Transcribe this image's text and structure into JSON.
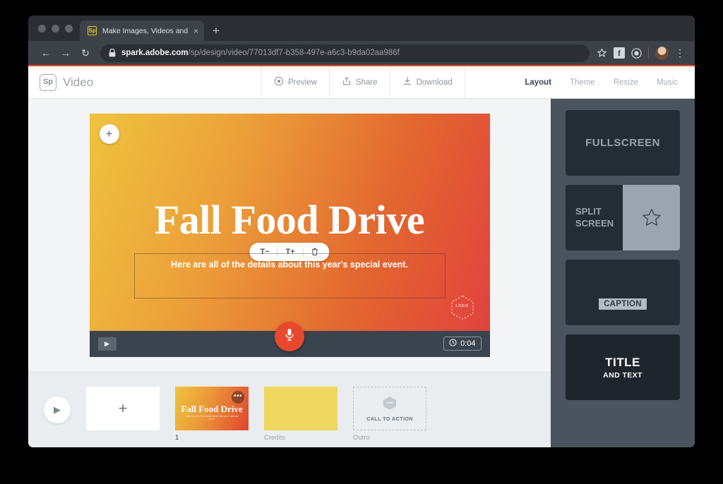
{
  "browser": {
    "tab": {
      "title": "Make Images, Videos and Web",
      "favicon_label": "Sp",
      "close_label": "×"
    },
    "new_tab_label": "+",
    "url": {
      "domain": "spark.adobe.com",
      "path": "/sp/design/video/77013df7-b358-497e-a6c3-b9da02aa986f"
    },
    "icons": {
      "back": "back-arrow-icon",
      "forward": "forward-arrow-icon",
      "reload": "reload-icon",
      "lock": "lock-icon",
      "bookmark": "star-icon",
      "facebook": "facebook-icon",
      "extension": "extension-icon",
      "avatar": "profile-avatar",
      "menu": "kebab-menu-icon"
    },
    "facebook_glyph": "f",
    "menu_glyph": "⋮",
    "back_glyph": "←",
    "forward_glyph": "→",
    "reload_glyph": "↻"
  },
  "header": {
    "logo_label": "Sp",
    "brand": "Video",
    "tools": [
      {
        "label": "Preview",
        "icon": "eye-icon"
      },
      {
        "label": "Share",
        "icon": "share-upload-icon"
      },
      {
        "label": "Download",
        "icon": "download-icon"
      }
    ],
    "nav": [
      {
        "label": "Layout",
        "active": true
      },
      {
        "label": "Theme",
        "active": false
      },
      {
        "label": "Resize",
        "active": false
      },
      {
        "label": "Music",
        "active": false
      }
    ]
  },
  "canvas": {
    "add_media_label": "+",
    "title": "Fall Food Drive",
    "subtitle": "Here are all of the details about this year's special event.",
    "text_toolbar": [
      {
        "label": "T−",
        "name": "decrease-text-size-button"
      },
      {
        "label": "T+",
        "name": "increase-text-size-button"
      },
      {
        "label": "🗑",
        "name": "delete-text-button"
      }
    ],
    "logo_placeholder": "LOGO",
    "player": {
      "play_glyph": "▶",
      "duration": "0:04",
      "record_icon": "microphone-icon"
    },
    "gradient": {
      "from": "#efc33e",
      "to": "#e14040"
    }
  },
  "timeline": {
    "play_glyph": "▶",
    "slides": [
      {
        "name": "add-slide",
        "caption": "",
        "add_label": "+"
      },
      {
        "name": "slide-1",
        "caption": "1",
        "title": "Fall Food Drive",
        "subtitle": "Here are all of the details about this year's special event.",
        "menu_label": "•••"
      },
      {
        "name": "credits",
        "caption": "Credits"
      },
      {
        "name": "outro",
        "caption": "Outro",
        "cta": "CALL TO ACTION",
        "logo": "LOGO"
      }
    ]
  },
  "layout_panel": {
    "options": [
      {
        "name": "fullscreen",
        "label": "FULLSCREEN"
      },
      {
        "name": "split-screen",
        "label": "SPLIT\nSCREEN",
        "line1": "SPLIT",
        "line2": "SCREEN",
        "icon": "star-icon"
      },
      {
        "name": "caption",
        "label": "CAPTION"
      },
      {
        "name": "title-and-text",
        "title": "TITLE",
        "subtitle": "AND TEXT",
        "selected": true
      }
    ]
  }
}
